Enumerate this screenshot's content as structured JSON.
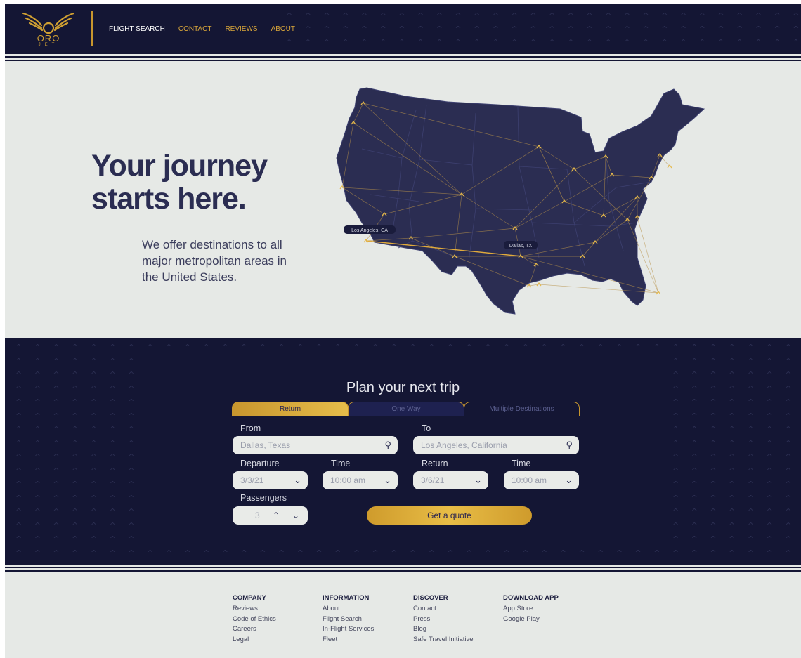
{
  "brand": {
    "name": "ORO",
    "sub": "JET"
  },
  "nav": {
    "items": [
      {
        "label": "FLIGHT SEARCH"
      },
      {
        "label": "CONTACT"
      },
      {
        "label": "REVIEWS"
      },
      {
        "label": "ABOUT"
      }
    ]
  },
  "hero": {
    "title_line1": "Your journey",
    "title_line2": "starts here.",
    "subtitle": "We offer destinations to all major metropolitan areas in the United States.",
    "map_labels": {
      "origin": "Los Angeles, CA",
      "destination": "Dallas, TX"
    }
  },
  "booking": {
    "title": "Plan your next trip",
    "tabs": [
      {
        "label": "Return"
      },
      {
        "label": "One Way"
      },
      {
        "label": "Multiple Destinations"
      }
    ],
    "from": {
      "label": "From",
      "value": "Dallas, Texas"
    },
    "to": {
      "label": "To",
      "value": "Los Angeles, California"
    },
    "departure": {
      "label": "Departure",
      "value": "3/3/21"
    },
    "departure_time": {
      "label": "Time",
      "value": "10:00 am"
    },
    "return": {
      "label": "Return",
      "value": "3/6/21"
    },
    "return_time": {
      "label": "Time",
      "value": "10:00 am"
    },
    "passengers": {
      "label": "Passengers",
      "value": "3"
    },
    "quote_button": "Get a quote"
  },
  "footer": {
    "columns": [
      {
        "heading": "COMPANY",
        "links": [
          "Reviews",
          "Code of Ethics",
          "Careers",
          "Legal"
        ]
      },
      {
        "heading": "INFORMATION",
        "links": [
          "About",
          "Flight Search",
          "In-Flight Services",
          "Fleet"
        ]
      },
      {
        "heading": "DISCOVER",
        "links": [
          "Contact",
          "Press",
          "Blog",
          "Safe Travel Initiative"
        ]
      },
      {
        "heading": "DOWNLOAD APP",
        "links": [
          "App Store",
          "Google Play"
        ]
      }
    ]
  },
  "colors": {
    "navy": "#141634",
    "gold": "#c8962e",
    "background": "#e6e9e6",
    "map": "#2b2d52"
  },
  "icons": [
    "wings-logo-icon",
    "search-icon",
    "chevron-down-icon",
    "chevron-up-icon",
    "plane-marker-icon"
  ]
}
